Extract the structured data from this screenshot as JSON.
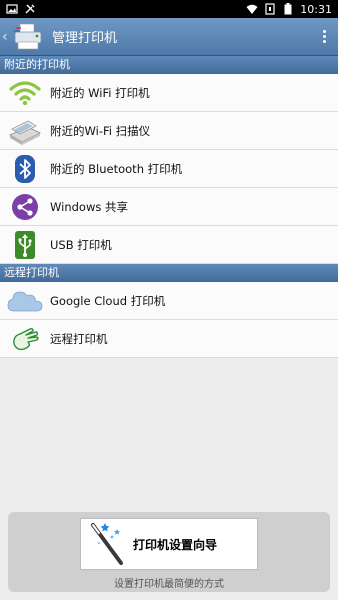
{
  "status_bar": {
    "time": "10:31"
  },
  "app_bar": {
    "title": "管理打印机"
  },
  "sections": {
    "nearby": {
      "header": "附近的打印机",
      "items": [
        {
          "label": "附近的 WiFi 打印机",
          "icon": "wifi-icon"
        },
        {
          "label": "附近的Wi-Fi 扫描仪",
          "icon": "scanner-icon"
        },
        {
          "label": "附近的 Bluetooth 打印机",
          "icon": "bluetooth-icon"
        },
        {
          "label": "Windows 共享",
          "icon": "share-icon"
        },
        {
          "label": "USB 打印机",
          "icon": "usb-icon"
        }
      ]
    },
    "remote": {
      "header": "远程打印机",
      "items": [
        {
          "label": "Google Cloud 打印机",
          "icon": "cloud-icon"
        },
        {
          "label": "远程打印机",
          "icon": "remote-hand-icon"
        }
      ]
    }
  },
  "bottom": {
    "wizard_label": "打印机设置向导",
    "caption": "设置打印机最简便的方式"
  },
  "colors": {
    "app_bar": "#5b87b8",
    "section_header": "#4f7aa9",
    "wifi_green": "#8cc63f",
    "bluetooth_blue": "#2a5db0",
    "share_purple": "#7b3fa8",
    "usb_green": "#3d8a2a",
    "cloud_blue": "#9bbde0"
  }
}
